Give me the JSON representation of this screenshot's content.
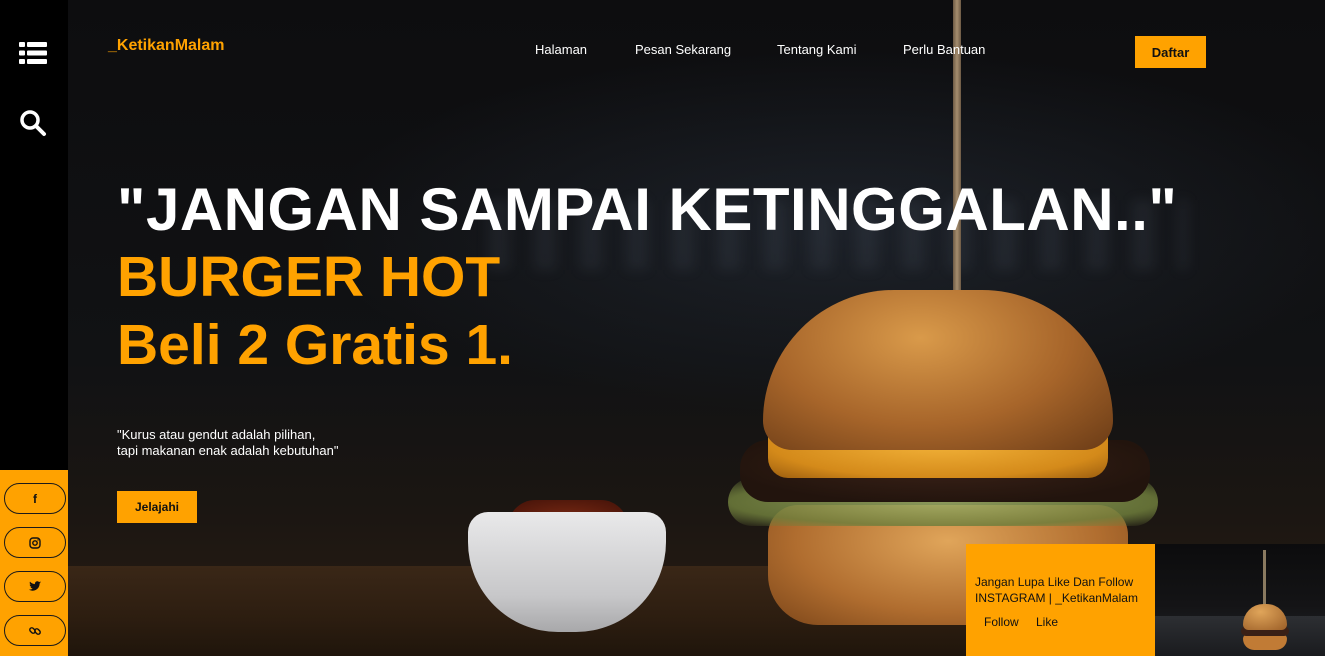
{
  "brand": "_KetikanMalam",
  "nav": {
    "items": [
      "Halaman",
      "Pesan Sekarang",
      "Tentang Kami",
      "Perlu Bantuan"
    ],
    "cta": "Daftar"
  },
  "sidebar": {
    "top_icons": [
      "menu-list-icon",
      "search-icon"
    ],
    "social": [
      {
        "name": "facebook",
        "glyph": "f"
      },
      {
        "name": "instagram",
        "glyph": "◎"
      },
      {
        "name": "twitter",
        "glyph": "🐦"
      },
      {
        "name": "link",
        "glyph": "🔗"
      }
    ]
  },
  "hero": {
    "headline": "\"JANGAN SAMPAI KETINGGALAN..\"",
    "subheadline": "BURGER HOT",
    "offer": "Beli 2 Gratis 1.",
    "quote_line1": "\"Kurus atau gendut adalah pilihan,",
    "quote_line2": "tapi makanan enak adalah kebutuhan\"",
    "button": "Jelajahi"
  },
  "promo": {
    "line1": "Jangan Lupa Like Dan Follow",
    "line2": "INSTAGRAM | _KetikanMalam",
    "follow": "Follow",
    "like": "Like"
  },
  "colors": {
    "accent": "#ffa200",
    "background": "#000000",
    "text": "#ffffff"
  }
}
